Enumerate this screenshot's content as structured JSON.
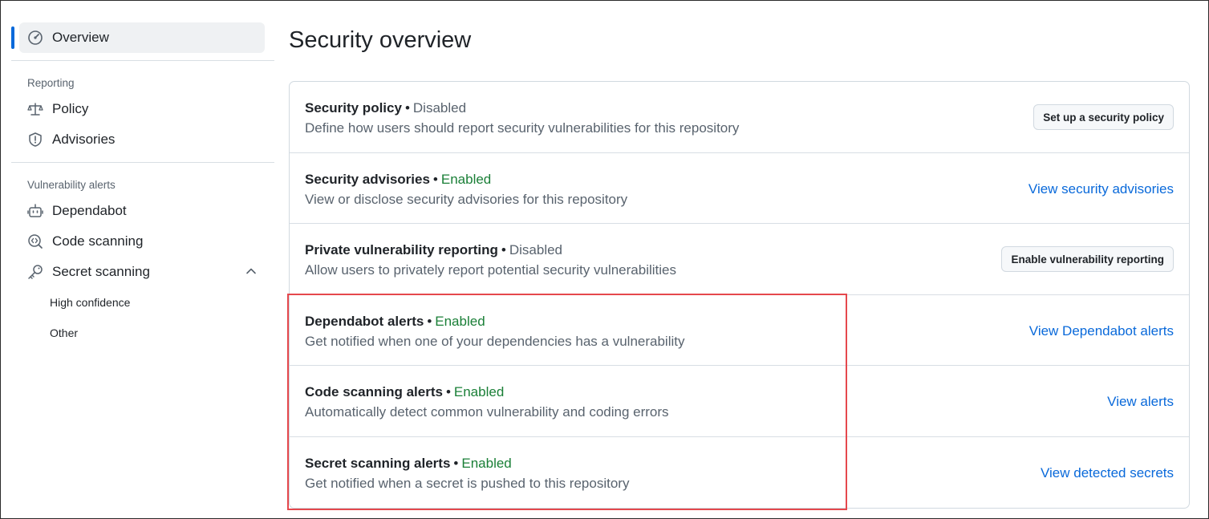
{
  "sidebar": {
    "overview": "Overview",
    "reporting_title": "Reporting",
    "policy": "Policy",
    "advisories": "Advisories",
    "vuln_title": "Vulnerability alerts",
    "dependabot": "Dependabot",
    "code_scanning": "Code scanning",
    "secret_scanning": "Secret scanning",
    "high_confidence": "High confidence",
    "other": "Other"
  },
  "main": {
    "title": "Security overview",
    "rows": [
      {
        "name": "Security policy",
        "status": "Disabled",
        "desc": "Define how users should report security vulnerabilities for this repository",
        "action": "Set up a security policy",
        "action_type": "button"
      },
      {
        "name": "Security advisories",
        "status": "Enabled",
        "desc": "View or disclose security advisories for this repository",
        "action": "View security advisories",
        "action_type": "link"
      },
      {
        "name": "Private vulnerability reporting",
        "status": "Disabled",
        "desc": "Allow users to privately report potential security vulnerabilities",
        "action": "Enable vulnerability reporting",
        "action_type": "button"
      },
      {
        "name": "Dependabot alerts",
        "status": "Enabled",
        "desc": "Get notified when one of your dependencies has a vulnerability",
        "action": "View Dependabot alerts",
        "action_type": "link"
      },
      {
        "name": "Code scanning alerts",
        "status": "Enabled",
        "desc": "Automatically detect common vulnerability and coding errors",
        "action": "View alerts",
        "action_type": "link"
      },
      {
        "name": "Secret scanning alerts",
        "status": "Enabled",
        "desc": "Get notified when a secret is pushed to this repository",
        "action": "View detected secrets",
        "action_type": "link"
      }
    ],
    "separator": "•"
  },
  "colors": {
    "accent": "#0969da",
    "enabled": "#1a7f37",
    "muted": "#59636e",
    "highlight": "#e5484d"
  }
}
